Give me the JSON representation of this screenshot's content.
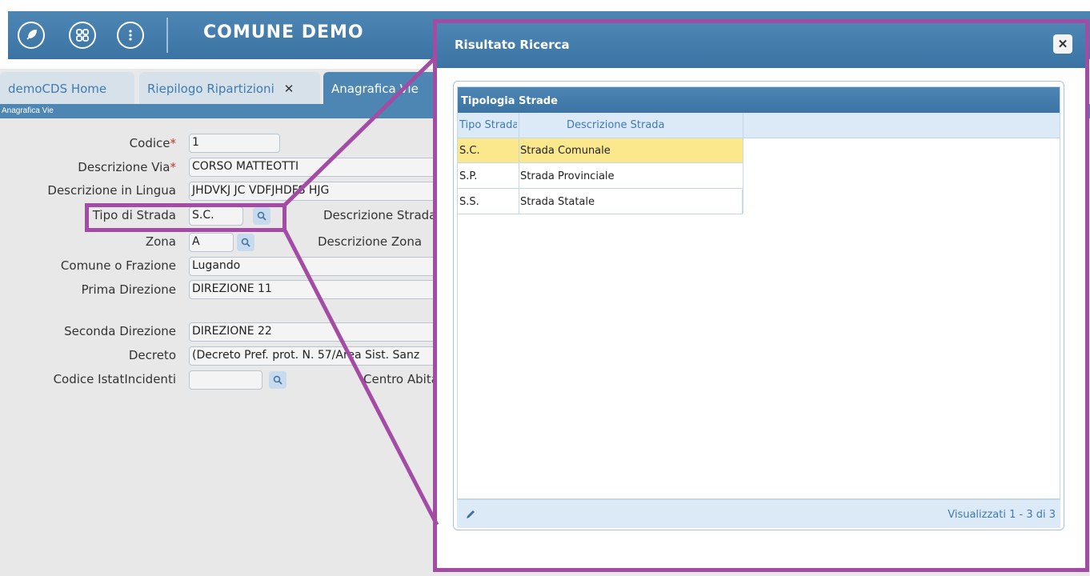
{
  "header": {
    "title": "COMUNE DEMO"
  },
  "tabs": [
    {
      "label": "demoCDS Home"
    },
    {
      "label": "Riepilogo Ripartizioni",
      "close": "✕"
    },
    {
      "label": "Anagrafica Vie"
    }
  ],
  "breadcrumb": "Anagrafica Vie",
  "form": {
    "codice_label": "Codice",
    "codice_value": "1",
    "descrizione_via_label": "Descrizione Via",
    "descrizione_via_value": "CORSO MATTEOTTI",
    "descrizione_lingua_label": "Descrizione in Lingua",
    "descrizione_lingua_value": "JHDVKJ JC VDFJHDFS HJG",
    "tipo_strada_label": "Tipo di Strada",
    "tipo_strada_value": "S.C.",
    "descrizione_strada_label": "Descrizione Strada",
    "zona_label": "Zona",
    "zona_value": "A",
    "descrizione_zona_label": "Descrizione Zona",
    "comune_label": "Comune o Frazione",
    "comune_value": "Lugando",
    "prima_dir_label": "Prima Direzione",
    "prima_dir_value": "DIREZIONE 11",
    "seconda_dir_label": "Seconda Direzione",
    "seconda_dir_value": "DIREZIONE 22",
    "decreto_label": "Decreto",
    "decreto_value": "(Decreto Pref. prot. N. 57/Area Sist. Sanz",
    "istat_label": "Codice IstatIncidenti",
    "istat_value": "",
    "centro_label": "Centro Abitato"
  },
  "dialog": {
    "title": "Risultato Ricerca",
    "close": "✕",
    "grid_caption": "Tipologia Strade",
    "columns": [
      "Tipo Strada",
      "Descrizione Strada"
    ],
    "rows": [
      {
        "tipo": "S.C.",
        "descrizione": "Strada Comunale"
      },
      {
        "tipo": "S.P.",
        "descrizione": "Strada Provinciale"
      },
      {
        "tipo": "S.S.",
        "descrizione": "Strada Statale"
      }
    ],
    "footer_info": "Visualizzati 1 - 3 di 3"
  },
  "colors": {
    "accent": "#4d86b3",
    "selected_row": "#fbe78c",
    "highlight": "#a44ba6"
  },
  "icons": [
    "rocket-icon",
    "grid-icon",
    "more-vertical-icon",
    "search-icon",
    "edit-pencil-icon",
    "close-icon"
  ]
}
